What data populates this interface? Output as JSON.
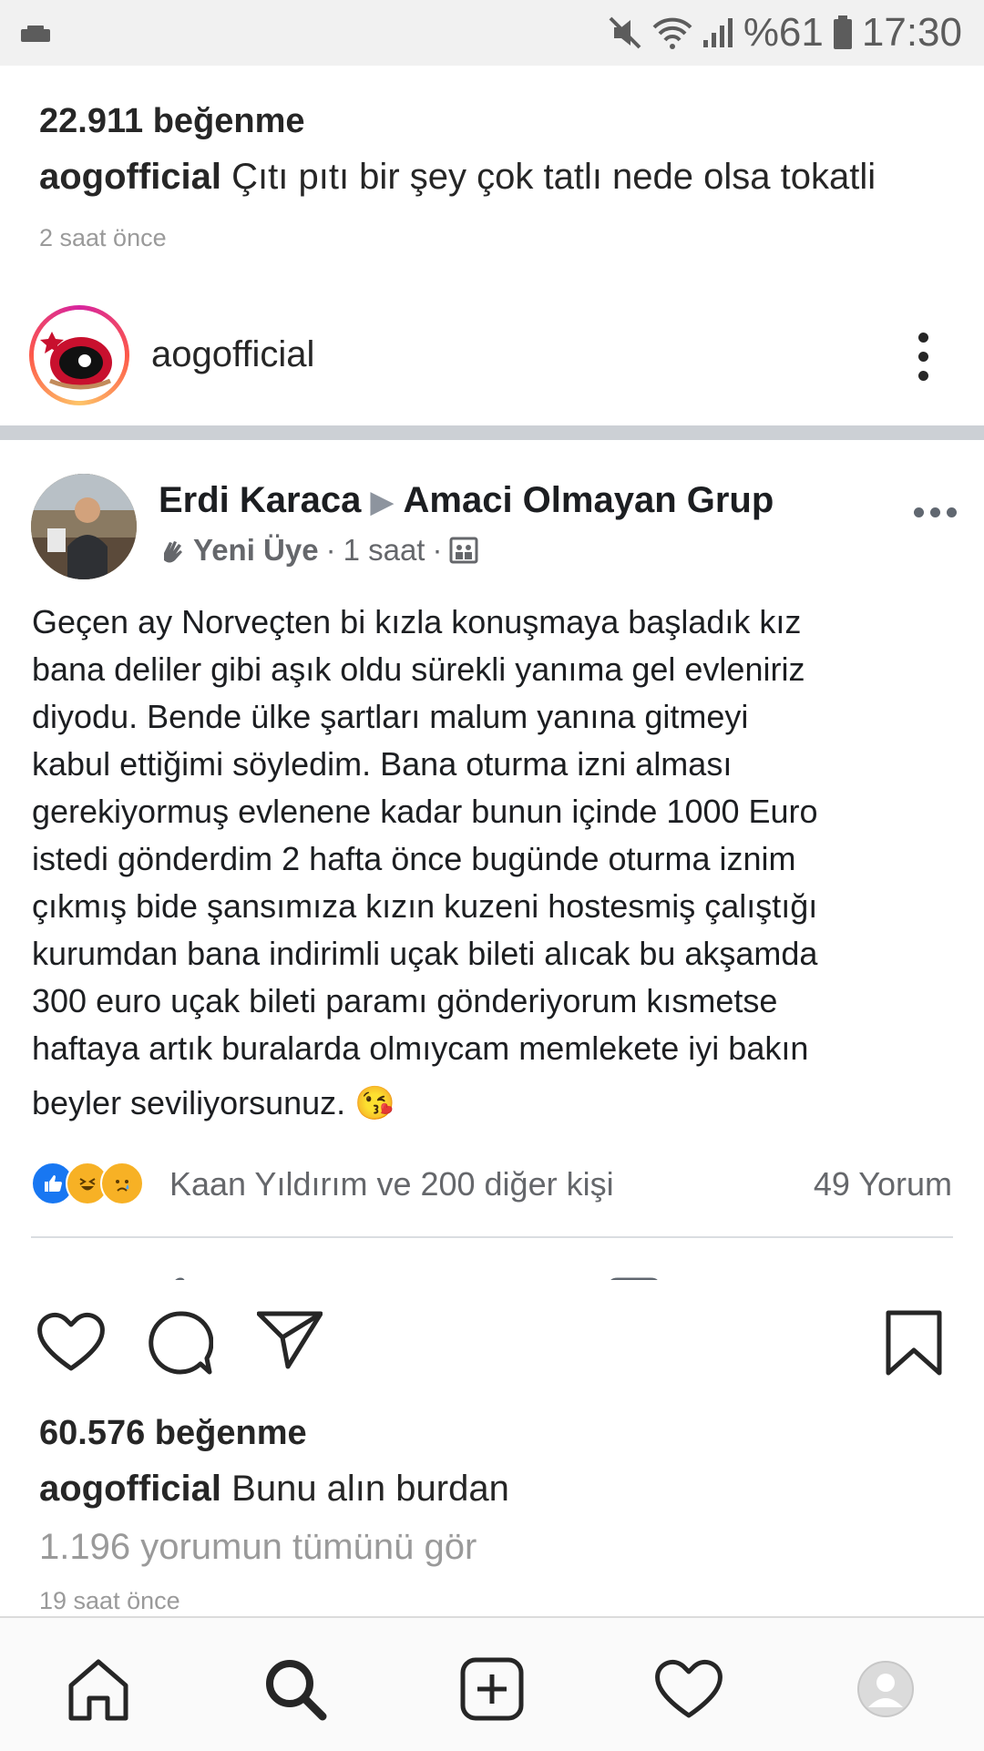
{
  "status_bar": {
    "battery": "%61",
    "time": "17:30",
    "icons": [
      "keyboard-icon",
      "mute-icon",
      "wifi-icon",
      "signal-icon",
      "battery-icon"
    ]
  },
  "previous_post": {
    "likes": "22.911 beğenme",
    "caption_user": "aogofficial",
    "caption_text": " Çıtı pıtı bir şey çok tatlı nede olsa tokatli",
    "time": "2 saat önce"
  },
  "post": {
    "username": "aogofficial",
    "image": {
      "author": "Erdi Karaca",
      "arrow": "▶",
      "group": "Amaci Olmayan Grup",
      "badge": "Yeni Üye",
      "time": "1 saat",
      "sep": "·",
      "text_lines": [
        "Geçen ay Norveçten bi kızla konuşmaya başladık kız",
        "bana deliler gibi aşık oldu sürekli yanıma gel evleniriz",
        "diyodu. Bende ülke şartları malum yanına gitmeyi",
        "kabul ettiğimi söyledim. Bana oturma izni alması",
        "gerekiyormuş evlenene kadar bunun içinde 1000 Euro",
        "istedi gönderdim 2 hafta önce bugünde oturma iznim",
        "çıkmış bide şansımıza kızın kuzeni hostesmiş çalıştığı",
        "kurumdan bana indirimli uçak bileti alıcak bu akşamda",
        "300 euro uçak bileti paramı gönderiyorum kısmetse",
        "haftaya artık buralarda olmıycam memlekete iyi bakın",
        "beyler seviliyorsunuz. 😘"
      ],
      "reactions_text": "Kaan Yıldırım ve 200 diğer kişi",
      "comments": "49 Yorum"
    },
    "likes": "60.576 beğenme",
    "caption_user": "aogofficial",
    "caption_text": " Bunu alın burdan",
    "view_comments": "1.196 yorumun tümünü gör",
    "time": "19 saat önce"
  },
  "colors": {
    "text": "#262626",
    "muted": "#9a9a9a",
    "fb_blue": "#1877f2",
    "status_bg": "#f1f1f1"
  }
}
